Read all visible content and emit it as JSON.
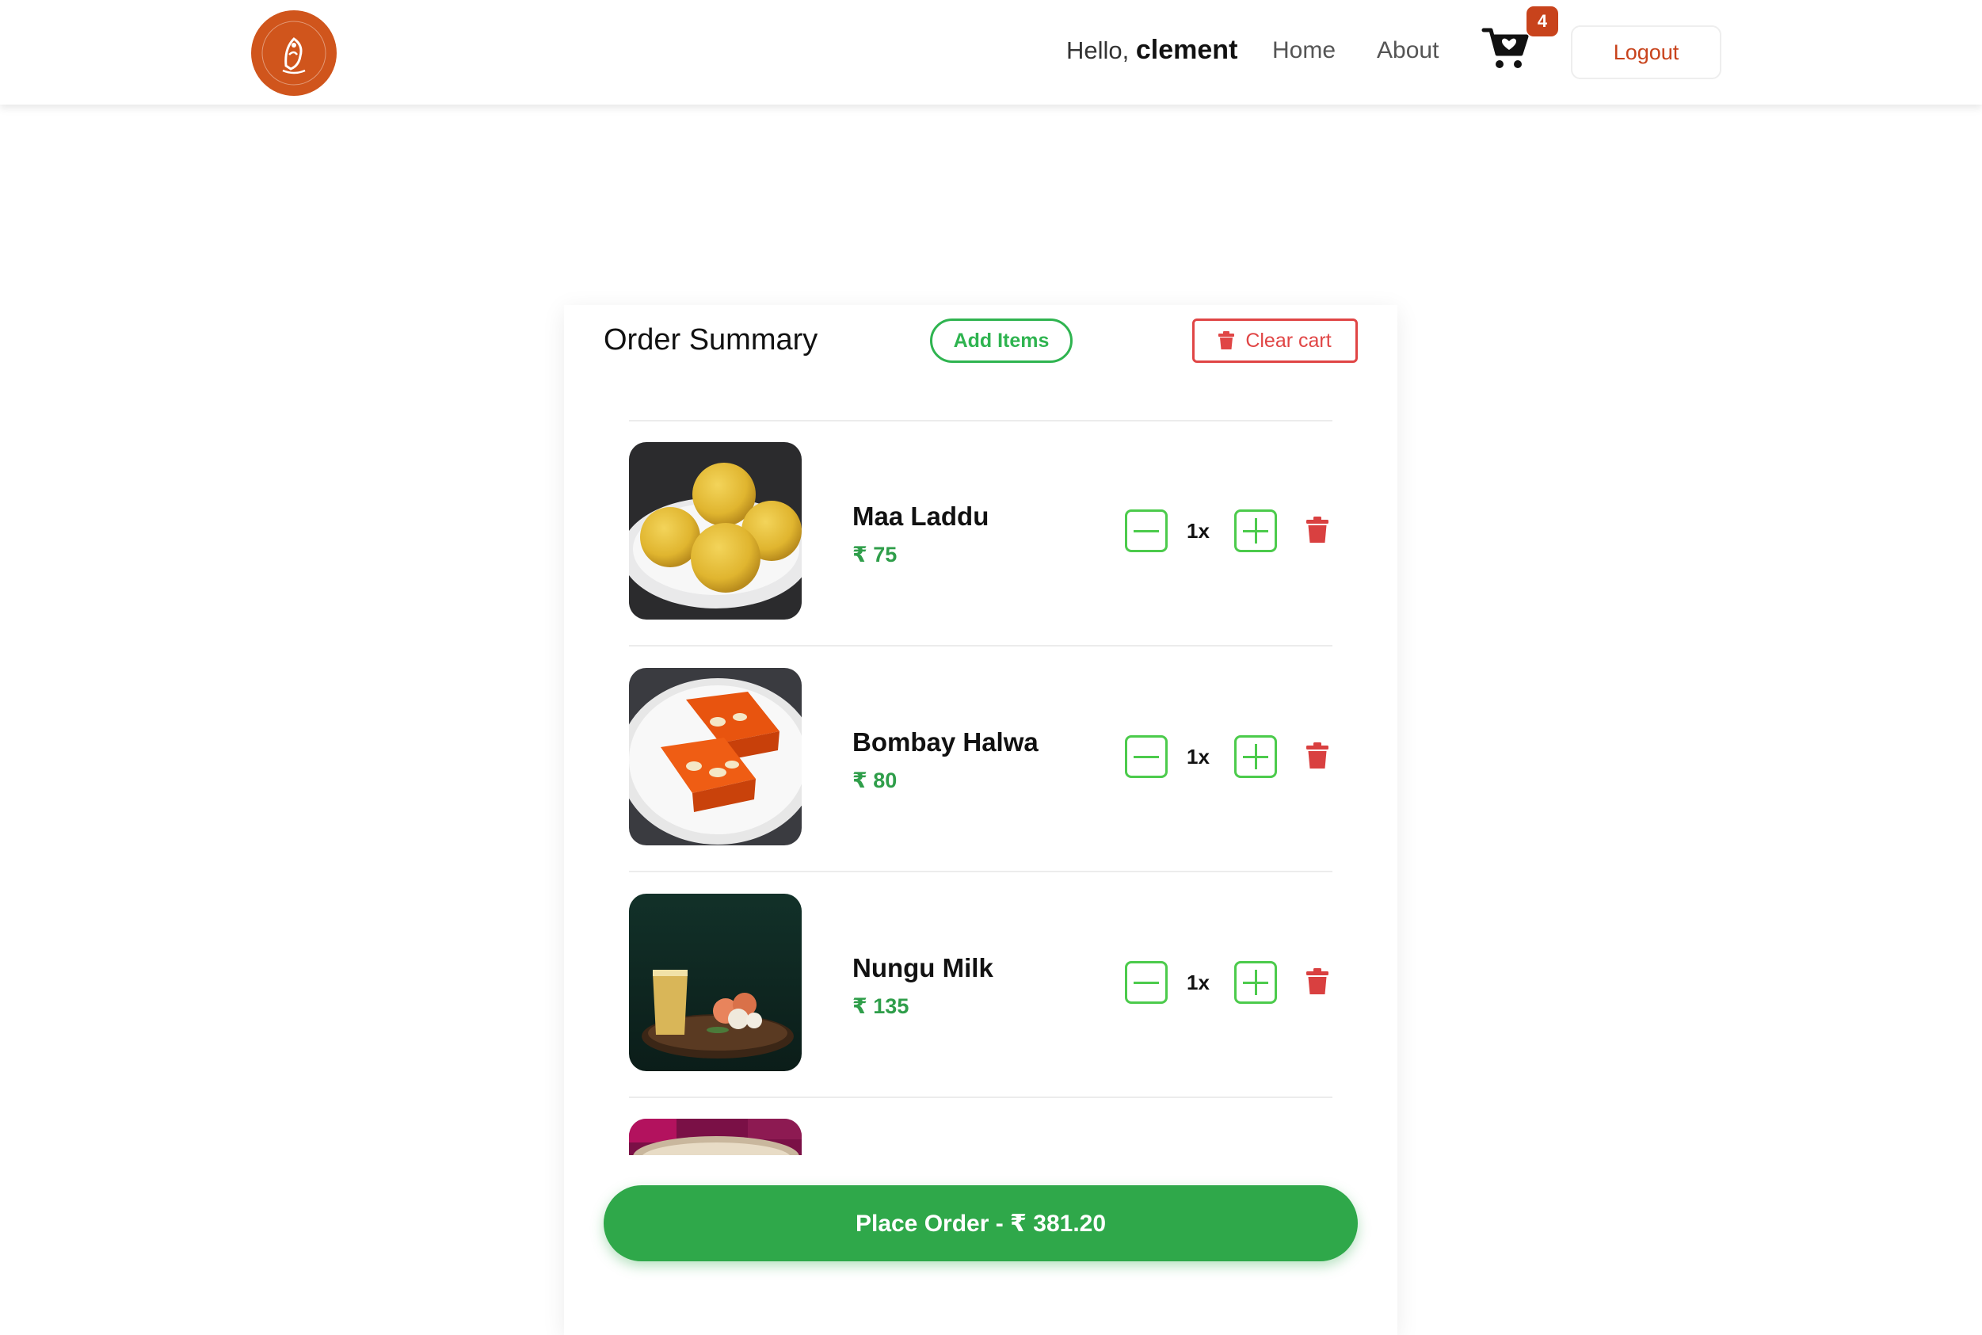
{
  "header": {
    "greeting": "Hello,",
    "username": "clement",
    "nav": {
      "home": "Home",
      "about": "About"
    },
    "cart_count": "4",
    "logout_label": "Logout",
    "logo_text": "ZESTYZING FLAVOR ELEVATED"
  },
  "summary": {
    "title": "Order Summary",
    "add_items_label": "Add Items",
    "clear_cart_label": "Clear cart"
  },
  "items": [
    {
      "name": "Maa Laddu",
      "price": "₹ 75",
      "qty": "1x"
    },
    {
      "name": "Bombay Halwa",
      "price": "₹ 80",
      "qty": "1x"
    },
    {
      "name": "Nungu Milk",
      "price": "₹ 135",
      "qty": "1x"
    }
  ],
  "place_order": {
    "label": "Place Order - ₹ 381.20"
  },
  "colors": {
    "brand": "#d0551c",
    "badge": "#c8431c",
    "green": "#2fb450",
    "order_green": "#2fa84a",
    "danger": "#e04545"
  }
}
